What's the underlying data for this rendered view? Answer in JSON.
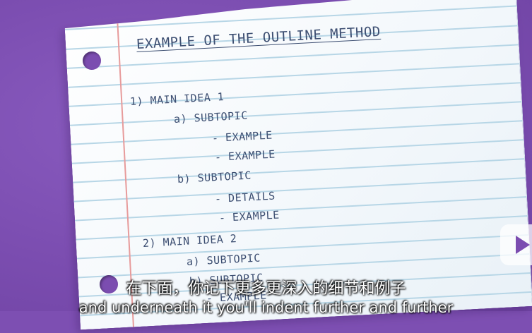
{
  "colors": {
    "background": "#7b4db0",
    "paper": "#f6f9fc",
    "ruling": "#b7d6e6",
    "margin_line": "#e79b9b",
    "ink": "#3d4f72",
    "subtitle_text": "#ffffff"
  },
  "notebook": {
    "title": "EXAMPLE OF THE OUTLINE METHOD",
    "lines": [
      "1) MAIN IDEA 1",
      "a) SUBTOPIC",
      "- EXAMPLE",
      "- EXAMPLE",
      "b) SUBTOPIC",
      "- DETAILS",
      "- EXAMPLE",
      "2) MAIN IDEA 2",
      "a) SUBTOPIC",
      "b) SUBTOPIC",
      "- EXAMPLE"
    ]
  },
  "badge": {
    "icon": "play-icon"
  },
  "subtitles": {
    "chinese": "在下面，你记下更多更深入的细节和例子",
    "english": "and underneath it you'll indent further and further"
  }
}
